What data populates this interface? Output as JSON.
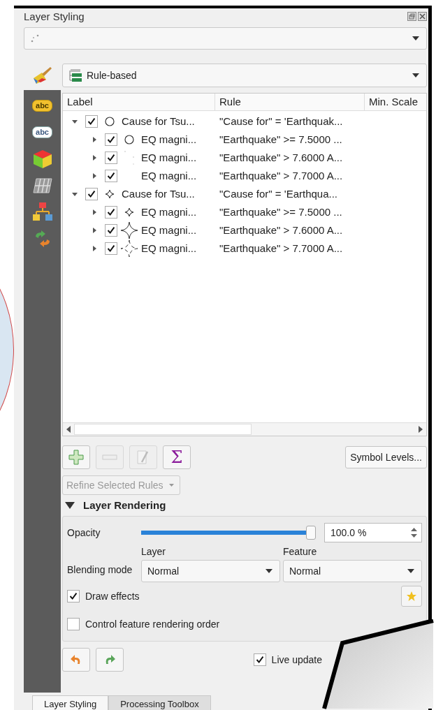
{
  "panel": {
    "title": "Layer Styling"
  },
  "sidebar": [
    {
      "kind": "symbology",
      "selected": true
    },
    {
      "kind": "labels",
      "text": "abc",
      "selected": false
    },
    {
      "kind": "masks",
      "text": "abc",
      "selected": false
    },
    {
      "kind": "cube",
      "selected": false
    },
    {
      "kind": "mesh",
      "selected": false
    },
    {
      "kind": "diagrams",
      "selected": false
    },
    {
      "kind": "history",
      "selected": false
    }
  ],
  "renderer": {
    "value": "Rule-based"
  },
  "tree": {
    "columns": [
      "Label",
      "Rule",
      "Min. Scale"
    ],
    "rows": [
      {
        "checked": true,
        "expanded": true,
        "kind": "circle",
        "label": "Cause for Tsu...",
        "rule": "\"Cause for\" = 'Earthquak...",
        "children": [
          {
            "checked": true,
            "expanded": false,
            "kind": "circle",
            "label": "EQ magni...",
            "rule": "\"Earthquake\" >= 7.5000 ..."
          },
          {
            "checked": true,
            "expanded": false,
            "kind": "dots",
            "label": "EQ magni...",
            "rule": "\"Earthquake\" > 7.6000 A..."
          },
          {
            "checked": true,
            "expanded": false,
            "kind": "blank",
            "label": "EQ magni...",
            "rule": "\"Earthquake\" > 7.7000 A..."
          }
        ]
      },
      {
        "checked": true,
        "expanded": true,
        "kind": "sparkle",
        "label": "Cause for Tsu...",
        "rule": "\"Cause for\"  =  'Earthqua...",
        "children": [
          {
            "checked": true,
            "expanded": false,
            "kind": "sparkle",
            "label": "EQ magni...",
            "rule": "\"Earthquake\" >= 7.5000 ..."
          },
          {
            "checked": true,
            "expanded": false,
            "kind": "sparklelarge",
            "label": "EQ magni...",
            "rule": "\"Earthquake\" > 7.6000 A..."
          },
          {
            "checked": true,
            "expanded": false,
            "kind": "sparkledashed",
            "label": "EQ magni...",
            "rule": "\"Earthquake\" > 7.7000 A..."
          }
        ]
      }
    ]
  },
  "rule_buttons": [
    {
      "kind": "add",
      "disabled": false
    },
    {
      "kind": "remove",
      "disabled": true
    },
    {
      "kind": "edit",
      "disabled": true
    },
    {
      "kind": "sum",
      "text": "Σ",
      "disabled": false
    }
  ],
  "symbol_levels": "Symbol Levels...",
  "refine": {
    "label": "Refine Selected Rules",
    "disabled": true
  },
  "rendering": {
    "title": "Layer Rendering",
    "expanded": true,
    "opacity": {
      "label": "Opacity",
      "level": 1.0,
      "value": "100.0 %"
    },
    "blending": {
      "label": "Blending mode",
      "layer_label": "Layer",
      "layer_value": "Normal",
      "feature_label": "Feature",
      "feature_value": "Normal"
    },
    "options": [
      {
        "label": "Draw effects",
        "checked": true
      },
      {
        "label": "Control feature rendering order",
        "checked": false
      }
    ]
  },
  "live_update": {
    "label": "Live update",
    "checked": true
  },
  "tabs": [
    {
      "label": "Layer Styling",
      "selected": true
    },
    {
      "label": "Processing Toolbox",
      "selected": false
    }
  ]
}
